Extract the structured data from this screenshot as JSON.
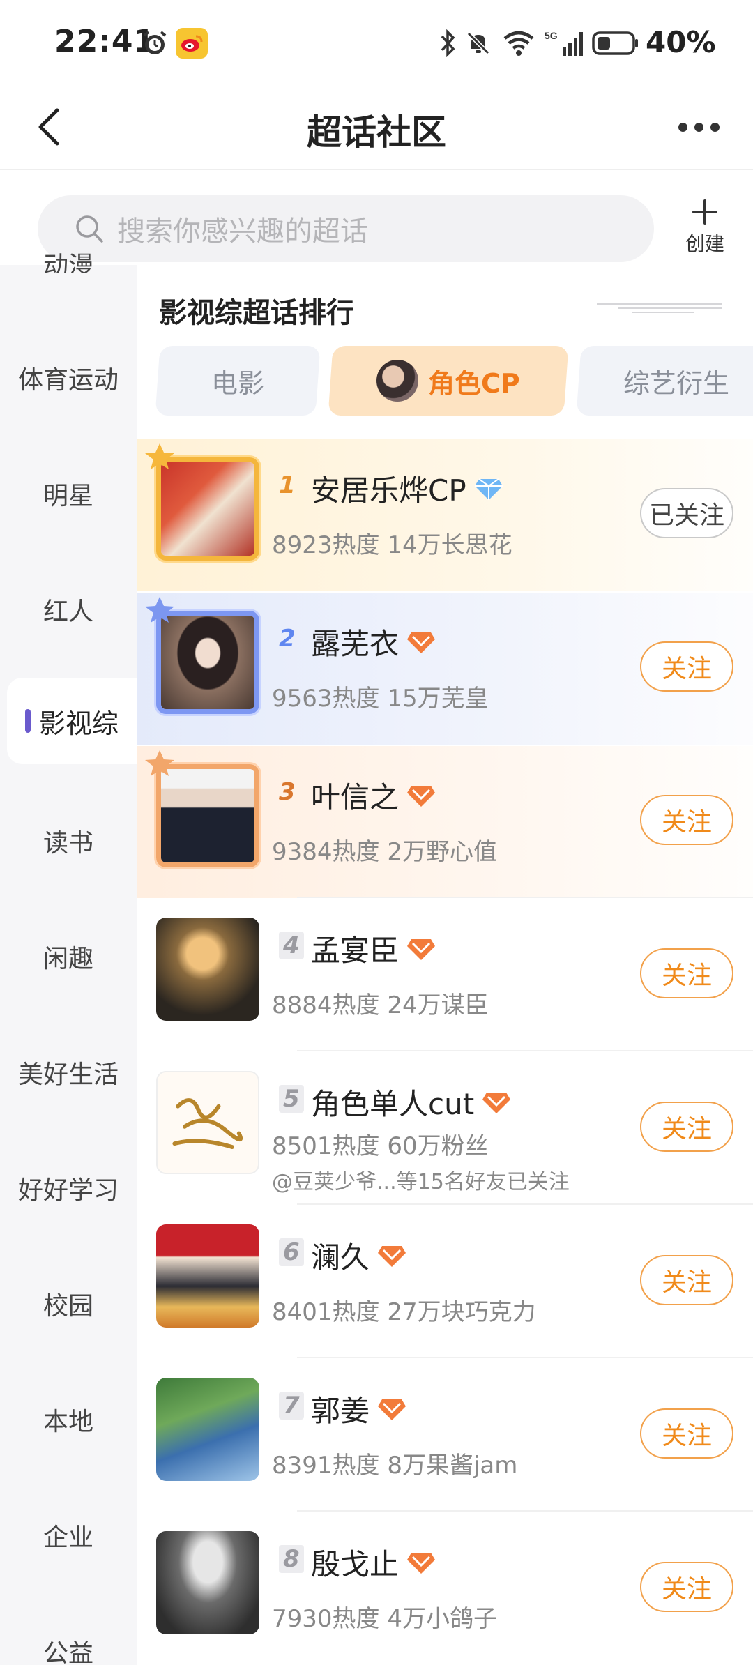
{
  "status_bar": {
    "time": "22:41",
    "network": "5G",
    "battery": "40%",
    "icons": [
      "alarm-icon",
      "weibo-app-icon",
      "bluetooth-icon",
      "mute-icon",
      "wifi-icon",
      "signal-icon",
      "battery-icon"
    ]
  },
  "header": {
    "title": "超话社区",
    "back_icon": "chevron-left-icon",
    "more_icon": "more-dots-icon"
  },
  "search": {
    "placeholder": "搜索你感兴趣的超话",
    "icon": "search-icon"
  },
  "create": {
    "label": "创建",
    "icon": "plus-icon"
  },
  "sidebar": {
    "partial_top": "动漫",
    "items": [
      "体育运动",
      "明星",
      "红人",
      "影视综",
      "读书",
      "闲趣",
      "美好生活",
      "好好学习",
      "校园",
      "本地",
      "企业",
      "公益"
    ],
    "active": "影视综"
  },
  "ranking": {
    "title": "影视综超话排行",
    "tabs": [
      "电影",
      "角色CP",
      "综艺衍生"
    ],
    "active_tab": "角色CP",
    "items": [
      {
        "rank": "1",
        "name": "安居乐烨CP",
        "stats": "8923热度 14万长思花",
        "button": "已关注",
        "friends": "",
        "badge": "diamond-icon"
      },
      {
        "rank": "2",
        "name": "露芜衣",
        "stats": "9563热度 15万芜皇",
        "button": "关注",
        "friends": "",
        "badge": "orange-diamond-icon"
      },
      {
        "rank": "3",
        "name": "叶信之",
        "stats": "9384热度 2万野心值",
        "button": "关注",
        "friends": "",
        "badge": "orange-diamond-icon"
      },
      {
        "rank": "4",
        "name": "孟宴臣",
        "stats": "8884热度 24万谋臣",
        "button": "关注",
        "friends": "",
        "badge": "orange-diamond-icon"
      },
      {
        "rank": "5",
        "name": "角色单人cut",
        "stats": "8501热度 60万粉丝",
        "button": "关注",
        "friends": "@豆荚少爷...等15名好友已关注",
        "badge": "orange-diamond-icon"
      },
      {
        "rank": "6",
        "name": "澜久",
        "stats": "8401热度 27万块巧克力",
        "button": "关注",
        "friends": "",
        "badge": "orange-diamond-icon"
      },
      {
        "rank": "7",
        "name": "郭姜",
        "stats": "8391热度 8万果酱jam",
        "button": "关注",
        "friends": "",
        "badge": "orange-diamond-icon"
      },
      {
        "rank": "8",
        "name": "殷戈止",
        "stats": "7930热度 4万小鸽子",
        "button": "关注",
        "friends": "",
        "badge": "orange-diamond-icon"
      }
    ]
  },
  "colors": {
    "accent": "#f08a1a",
    "active_tab_bg": "#fde3c2",
    "sidebar_bg": "#f6f6f8",
    "sidebar_active_bar": "#6a5acd"
  }
}
